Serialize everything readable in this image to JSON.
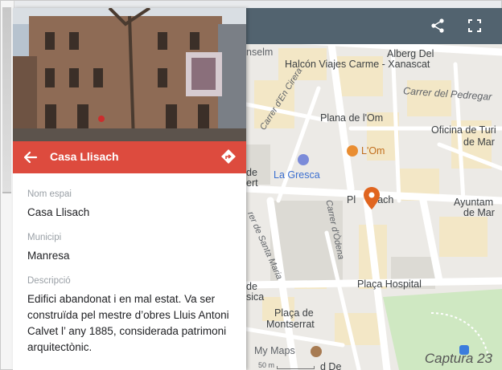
{
  "panel": {
    "title": "Casa Llisach",
    "fields": [
      {
        "label": "Nom espai",
        "value": "Casa Llisach"
      },
      {
        "label": "Municipi",
        "value": "Manresa"
      },
      {
        "label": "Descripció",
        "value": "Edifici abandonat i en mal estat.  Va ser construïda pel mestre d’obres Lluis Antoni Calvet l’ any 1885, considerada patrimoni arquitectònic."
      }
    ]
  },
  "map": {
    "labels": {
      "anselm": "nselm",
      "halcon": "Halcón Viajes Carme - Xanascat",
      "alberg": "Alberg Del",
      "pedregar": "Carrer del Pedregar",
      "cirera": "Carrer d'En Cirera",
      "plana": "Plana de l'Om",
      "oficina": "Oficina de Turi",
      "oficina2": "de Mar",
      "lom": "L'Om",
      "de": "de",
      "ert": "ert",
      "gresca": "La Gresca",
      "llisach": "Pl      sach",
      "ajuntam": "Ayuntam",
      "ajuntam2": "de Mar",
      "odena": "Carrer d'Òdena",
      "santamaria": "rer de Santa Maria",
      "de2": "de",
      "sica": "sica",
      "hospital": "Plaça Hospital",
      "montserrat1": "Plaça de",
      "montserrat2": "Montserrat",
      "mymaps": "My Maps",
      "scale": "50 m",
      "dode": "d De"
    },
    "caption": "Captura 23"
  },
  "icons": {
    "share": "share-icon",
    "fullscreen": "fullscreen-icon",
    "back": "back-arrow-icon",
    "directions": "directions-icon",
    "pin": "map-pin-icon"
  },
  "colors": {
    "header": "#dd4b3e",
    "topbar": "#52636f",
    "pin": "#e0651f"
  }
}
